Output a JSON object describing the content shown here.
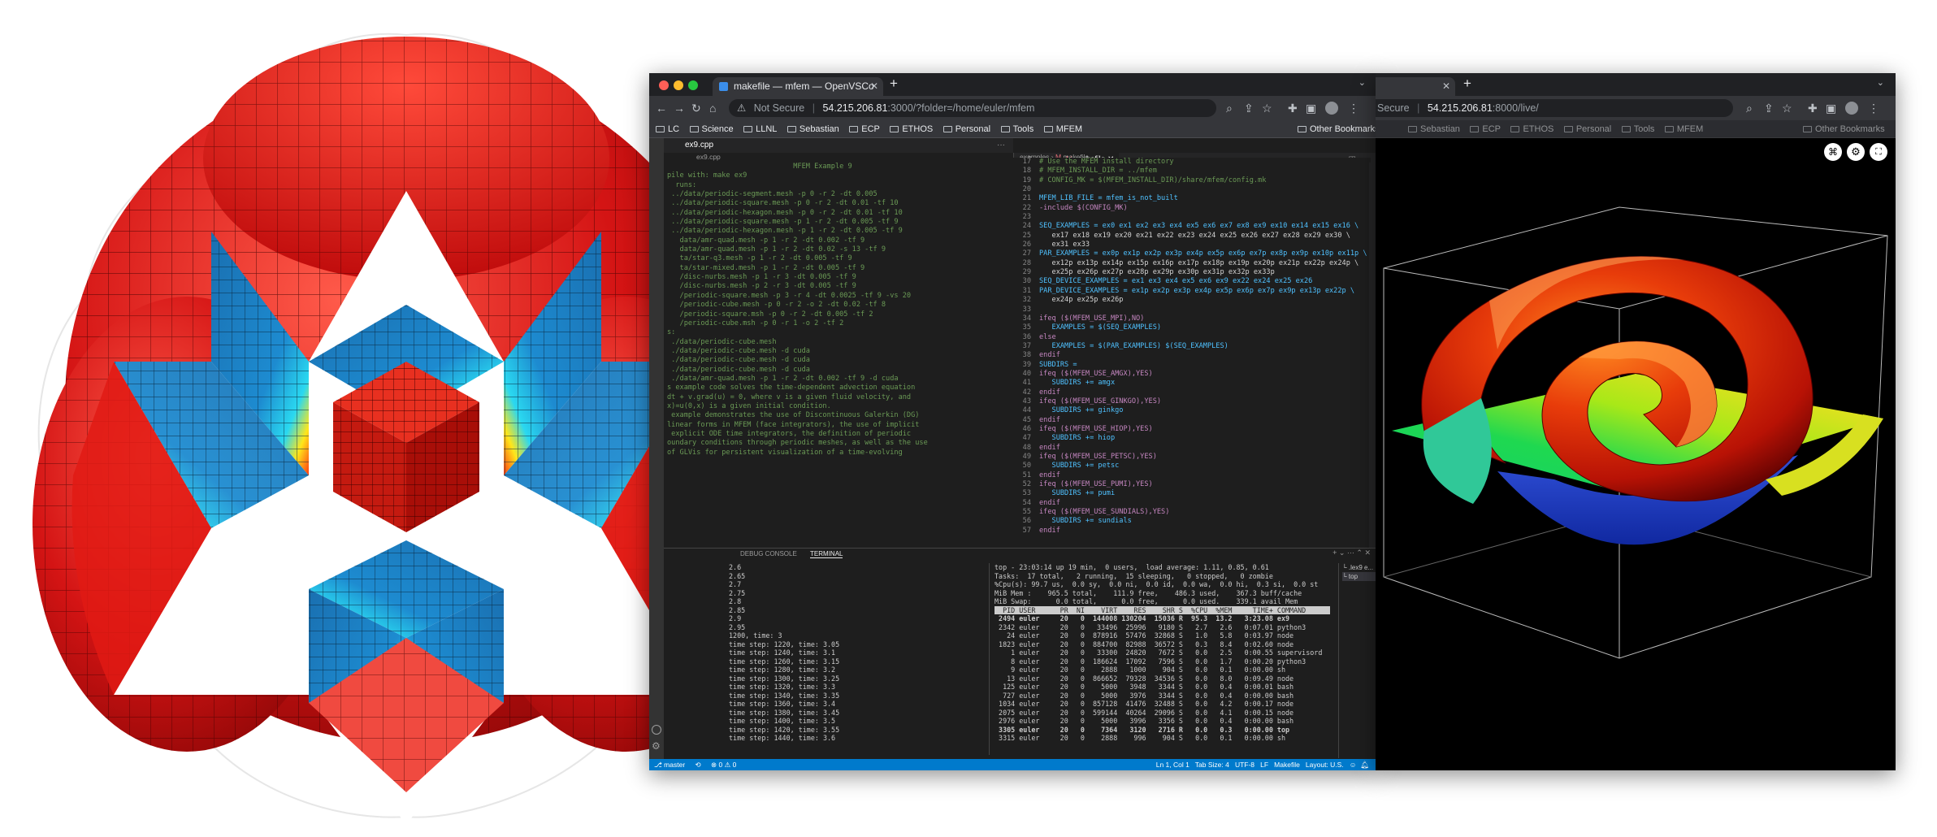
{
  "vscode_window": {
    "tab_title": "makefile — mfem — OpenVSCo",
    "url_security": "Not Secure",
    "url_host": "54.215.206.81",
    "url_path": ":3000/?folder=/home/euler/mfem",
    "bookmarks": [
      "LC",
      "Science",
      "LLNL",
      "Sebastian",
      "ECP",
      "ETHOS",
      "Personal",
      "Tools",
      "MFEM"
    ],
    "other_bookmarks": "Other Bookmarks",
    "left_editor": {
      "tab": "ex9.cpp",
      "breadcrumb": "ex9.cpp",
      "lines": [
        "                              MFEM Example 9",
        "",
        "pile with: make ex9",
        "",
        "  runs:",
        " ../data/periodic-segment.mesh -p 0 -r 2 -dt 0.005",
        " ../data/periodic-square.mesh -p 0 -r 2 -dt 0.01 -tf 10",
        " ../data/periodic-hexagon.mesh -p 0 -r 2 -dt 0.01 -tf 10",
        " ../data/periodic-square.mesh -p 1 -r 2 -dt 0.005 -tf 9",
        " ../data/periodic-hexagon.mesh -p 1 -r 2 -dt 0.005 -tf 9",
        "   data/amr-quad.mesh -p 1 -r 2 -dt 0.002 -tf 9",
        "   data/amr-quad.mesh -p 1 -r 2 -dt 0.02 -s 13 -tf 9",
        "   ta/star-q3.mesh -p 1 -r 2 -dt 0.005 -tf 9",
        "   ta/star-mixed.mesh -p 1 -r 2 -dt 0.005 -tf 9",
        "   /disc-nurbs.mesh -p 1 -r 3 -dt 0.005 -tf 9",
        "   /disc-nurbs.mesh -p 2 -r 3 -dt 0.005 -tf 9",
        "   /periodic-square.mesh -p 3 -r 4 -dt 0.0025 -tf 9 -vs 20",
        "   /periodic-cube.mesh -p 0 -r 2 -o 2 -dt 0.02 -tf 8",
        "   /periodic-square.msh -p 0 -r 2 -dt 0.005 -tf 2",
        "   /periodic-cube.msh -p 0 -r 1 -o 2 -tf 2",
        "",
        "s:",
        "",
        "",
        " ./data/periodic-cube.mesh",
        " ./data/periodic-cube.mesh -d cuda",
        " ./data/periodic-cube.mesh -d cuda",
        " ./data/periodic-cube.mesh -d cuda",
        " ./data/amr-quad.mesh -p 1 -r 2 -dt 0.002 -tf 9 -d cuda",
        "",
        "s example code solves the time-dependent advection equation",
        "dt + v.grad(u) = 0, where v is a given fluid velocity, and",
        "x)=u(0,x) is a given initial condition.",
        "",
        " example demonstrates the use of Discontinuous Galerkin (DG)",
        "linear forms in MFEM (face integrators), the use of implicit",
        " explicit ODE time integrators, the definition of periodic",
        "oundary conditions through periodic meshes, as well as the use",
        "of GLVis for persistent visualization of a time-evolving"
      ]
    },
    "right_editor": {
      "tabs": [
        "ex9.cpp",
        "makefile"
      ],
      "breadcrumb": [
        "examples",
        "makefile"
      ],
      "lines": [
        {
          "n": "17",
          "t": "# Use the MFEM install directory"
        },
        {
          "n": "18",
          "t": "# MFEM_INSTALL_DIR = ../mfem"
        },
        {
          "n": "19",
          "t": "# CONFIG_MK = $(MFEM_INSTALL_DIR)/share/mfem/config.mk"
        },
        {
          "n": "20",
          "t": ""
        },
        {
          "n": "21",
          "t": "MFEM_LIB_FILE = mfem_is_not_built"
        },
        {
          "n": "22",
          "t": "-include $(CONFIG_MK)"
        },
        {
          "n": "23",
          "t": ""
        },
        {
          "n": "24",
          "t": "SEQ_EXAMPLES = ex0 ex1 ex2 ex3 ex4 ex5 ex6 ex7 ex8 ex9 ex10 ex14 ex15 ex16 \\"
        },
        {
          "n": "25",
          "t": "   ex17 ex18 ex19 ex20 ex21 ex22 ex23 ex24 ex25 ex26 ex27 ex28 ex29 ex30 \\"
        },
        {
          "n": "26",
          "t": "   ex31 ex33"
        },
        {
          "n": "27",
          "t": "PAR_EXAMPLES = ex0p ex1p ex2p ex3p ex4p ex5p ex6p ex7p ex8p ex9p ex10p ex11p \\"
        },
        {
          "n": "28",
          "t": "   ex12p ex13p ex14p ex15p ex16p ex17p ex18p ex19p ex20p ex21p ex22p ex24p \\"
        },
        {
          "n": "29",
          "t": "   ex25p ex26p ex27p ex28p ex29p ex30p ex31p ex32p ex33p"
        },
        {
          "n": "30",
          "t": "SEQ_DEVICE_EXAMPLES = ex1 ex3 ex4 ex5 ex6 ex9 ex22 ex24 ex25 ex26"
        },
        {
          "n": "31",
          "t": "PAR_DEVICE_EXAMPLES = ex1p ex2p ex3p ex4p ex5p ex6p ex7p ex9p ex13p ex22p \\"
        },
        {
          "n": "32",
          "t": "   ex24p ex25p ex26p"
        },
        {
          "n": "33",
          "t": ""
        },
        {
          "n": "34",
          "t": "ifeq ($(MFEM_USE_MPI),NO)"
        },
        {
          "n": "35",
          "t": "   EXAMPLES = $(SEQ_EXAMPLES)"
        },
        {
          "n": "36",
          "t": "else"
        },
        {
          "n": "37",
          "t": "   EXAMPLES = $(PAR_EXAMPLES) $(SEQ_EXAMPLES)"
        },
        {
          "n": "38",
          "t": "endif"
        },
        {
          "n": "39",
          "t": "SUBDIRS ="
        },
        {
          "n": "40",
          "t": "ifeq ($(MFEM_USE_AMGX),YES)"
        },
        {
          "n": "41",
          "t": "   SUBDIRS += amgx"
        },
        {
          "n": "42",
          "t": "endif"
        },
        {
          "n": "43",
          "t": "ifeq ($(MFEM_USE_GINKGO),YES)"
        },
        {
          "n": "44",
          "t": "   SUBDIRS += ginkgo"
        },
        {
          "n": "45",
          "t": "endif"
        },
        {
          "n": "46",
          "t": "ifeq ($(MFEM_USE_HIOP),YES)"
        },
        {
          "n": "47",
          "t": "   SUBDIRS += hiop"
        },
        {
          "n": "48",
          "t": "endif"
        },
        {
          "n": "49",
          "t": "ifeq ($(MFEM_USE_PETSC),YES)"
        },
        {
          "n": "50",
          "t": "   SUBDIRS += petsc"
        },
        {
          "n": "51",
          "t": "endif"
        },
        {
          "n": "52",
          "t": "ifeq ($(MFEM_USE_PUMI),YES)"
        },
        {
          "n": "53",
          "t": "   SUBDIRS += pumi"
        },
        {
          "n": "54",
          "t": "endif"
        },
        {
          "n": "55",
          "t": "ifeq ($(MFEM_USE_SUNDIALS),YES)"
        },
        {
          "n": "56",
          "t": "   SUBDIRS += sundials"
        },
        {
          "n": "57",
          "t": "endif"
        }
      ]
    },
    "panel_tabs": [
      "DEBUG CONSOLE",
      "TERMINAL"
    ],
    "terminal_instances": [
      ".lex9 e...",
      "top"
    ],
    "terminal_left": [
      "2.6",
      "2.65",
      "2.7",
      "2.75",
      "2.8",
      "2.85",
      "2.9",
      "2.95",
      "1200, time: 3",
      "time step: 1220, time: 3.05",
      "time step: 1240, time: 3.1",
      "time step: 1260, time: 3.15",
      "time step: 1280, time: 3.2",
      "time step: 1300, time: 3.25",
      "time step: 1320, time: 3.3",
      "time step: 1340, time: 3.35",
      "time step: 1360, time: 3.4",
      "time step: 1380, time: 3.45",
      "time step: 1400, time: 3.5",
      "time step: 1420, time: 3.55",
      "time step: 1440, time: 3.6"
    ],
    "terminal_top_header": [
      "top - 23:03:14 up 19 min,  0 users,  load average: 1.11, 0.85, 0.61",
      "Tasks:  17 total,   2 running,  15 sleeping,   0 stopped,   0 zombie",
      "%Cpu(s): 99.7 us,  0.0 sy,  0.0 ni,  0.0 id,  0.0 wa,  0.0 hi,  0.3 si,  0.0 st",
      "MiB Mem :    965.5 total,    111.9 free,    486.3 used,    367.3 buff/cache",
      "MiB Swap:      0.0 total,      0.0 free,      0.0 used.    339.1 avail Mem"
    ],
    "terminal_top_columns": "  PID USER      PR  NI    VIRT    RES    SHR S  %CPU  %MEM     TIME+ COMMAND",
    "terminal_top_rows": [
      " 2494 euler     20   0  144008 130204  15036 R  95.3  13.2   3:23.08 ex9",
      " 2342 euler     20   0   33496  25996   9180 S   2.7   2.6   0:07.01 python3",
      "   24 euler     20   0  878916  57476  32868 S   1.0   5.8   0:03.97 node",
      " 1823 euler     20   0  884700  82988  36572 S   0.3   8.4   0:02.60 node",
      "    1 euler     20   0   33300  24820   7672 S   0.0   2.5   0:00.55 supervisord",
      "    8 euler     20   0  186624  17092   7596 S   0.0   1.7   0:00.20 python3",
      "    9 euler     20   0    2888   1000    904 S   0.0   0.1   0:00.00 sh",
      "   13 euler     20   0  866652  79328  34536 S   0.0   8.0   0:09.49 node",
      "  125 euler     20   0    5000   3948   3344 S   0.0   0.4   0:00.01 bash",
      "  727 euler     20   0    5000   3976   3344 S   0.0   0.4   0:00.00 bash",
      " 1034 euler     20   0  857128  41476  32488 S   0.0   4.2   0:00.17 node",
      " 2075 euler     20   0  599144  40264  29096 S   0.0   4.1   0:00.15 node",
      " 2976 euler     20   0    5000   3996   3356 S   0.0   0.4   0:00.00 bash",
      " 3305 euler     20   0    7364   3120   2716 R   0.0   0.3   0:00.00 top",
      " 3315 euler     20   0    2888    996    904 S   0.0   0.1   0:00.00 sh"
    ],
    "status_bar": {
      "branch": "master",
      "problems": "0 ⚠ 0",
      "position": "Ln 1, Col 1",
      "tab_size": "Tab Size: 4",
      "encoding": "UTF-8",
      "eol": "LF",
      "language": "Makefile",
      "layout": "Layout: U.S."
    }
  },
  "glvis_window": {
    "url_security": "Secure",
    "url_host": "54.215.206.81",
    "url_path": ":8000/live/",
    "bookmarks": [
      "Sebastian",
      "ECP",
      "ETHOS",
      "Personal",
      "Tools",
      "MFEM"
    ],
    "other_bookmarks": "Other Bookmarks"
  },
  "colors": {
    "vscode_accent": "#007acc",
    "chrome_dark": "#202124",
    "mesh_red": "#d01212",
    "mesh_blue": "#1e88c8",
    "mesh_cyan": "#2ad8f0"
  },
  "icons": [
    "folder-icon",
    "refresh-icon",
    "back-icon",
    "forward-icon",
    "home-icon",
    "lock-icon",
    "extension-icon",
    "profile-icon",
    "menu-icon",
    "gear-icon",
    "screenshot-icon",
    "settings-icon"
  ]
}
